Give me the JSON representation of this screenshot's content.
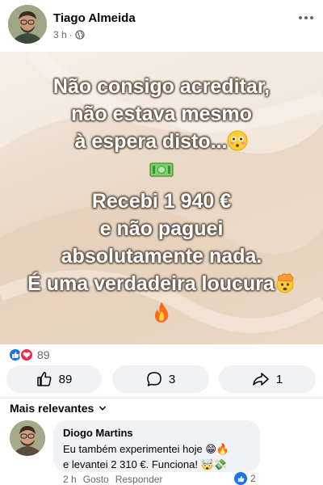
{
  "post": {
    "author": "Tiago Almeida",
    "time": "3 h",
    "separator": "·",
    "lines": [
      "Não consigo acreditar,",
      "não estava mesmo",
      "à espera disto..."
    ],
    "lines2": [
      "Recebi 1 940 €",
      "e não paguei",
      "absolutamente nada.",
      "É uma verdadeira loucura"
    ],
    "reaction_count": "89"
  },
  "actions": {
    "like_count": "89",
    "comment_count": "3",
    "share_count": "1"
  },
  "comments": {
    "sort_label": "Mais relevantes",
    "items": [
      {
        "author": "Diogo Martins",
        "line1": "Eu também experimentei hoje 😁🔥",
        "line2": "e levantei 2 310 €. Funciona! 🤯💸",
        "time": "2 h",
        "like_label": "Gosto",
        "reply_label": "Responder",
        "reaction_count": "2"
      }
    ]
  },
  "colors": {
    "accent": "#1b74e4",
    "love": "#f0284a",
    "muted": "#65676b",
    "bubble": "#f0f2f5"
  },
  "icons": [
    "more-icon",
    "globe-icon",
    "money-icon",
    "flushed-face-icon",
    "mind-blown-icon",
    "fire-icon",
    "like-icon",
    "love-icon",
    "comment-icon",
    "share-icon",
    "chevron-down-icon"
  ]
}
